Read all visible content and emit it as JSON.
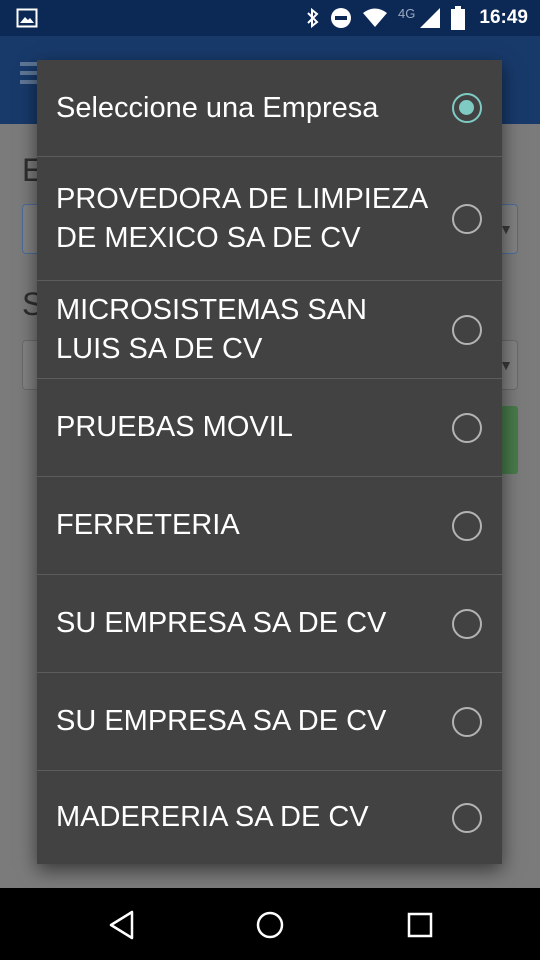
{
  "status_bar": {
    "network": "4G",
    "time": "16:49",
    "icons": [
      "image-icon",
      "bluetooth-icon",
      "do-not-disturb-icon",
      "wifi-icon",
      "signal-icon",
      "battery-icon"
    ]
  },
  "dialog": {
    "options": [
      {
        "label": "Seleccione una Empresa",
        "selected": true
      },
      {
        "label": "PROVEDORA DE LIMPIEZA DE MEXICO SA DE CV",
        "selected": false
      },
      {
        "label": "MICROSISTEMAS SAN LUIS SA DE CV",
        "selected": false
      },
      {
        "label": "PRUEBAS MOVIL",
        "selected": false
      },
      {
        "label": "FERRETERIA",
        "selected": false
      },
      {
        "label": "SU EMPRESA SA DE CV",
        "selected": false
      },
      {
        "label": "SU EMPRESA SA DE CV",
        "selected": false
      },
      {
        "label": "MADERERIA SA DE CV",
        "selected": false
      }
    ]
  },
  "background": {
    "label_1": "E",
    "label_2": "S"
  },
  "colors": {
    "accent": "#7fcbc4",
    "dialog_bg": "#424242",
    "toolbar": "#183a6b",
    "status_bar": "#0c2855"
  },
  "nav_bar": {
    "icons": [
      "back-icon",
      "home-icon",
      "recents-icon"
    ]
  }
}
